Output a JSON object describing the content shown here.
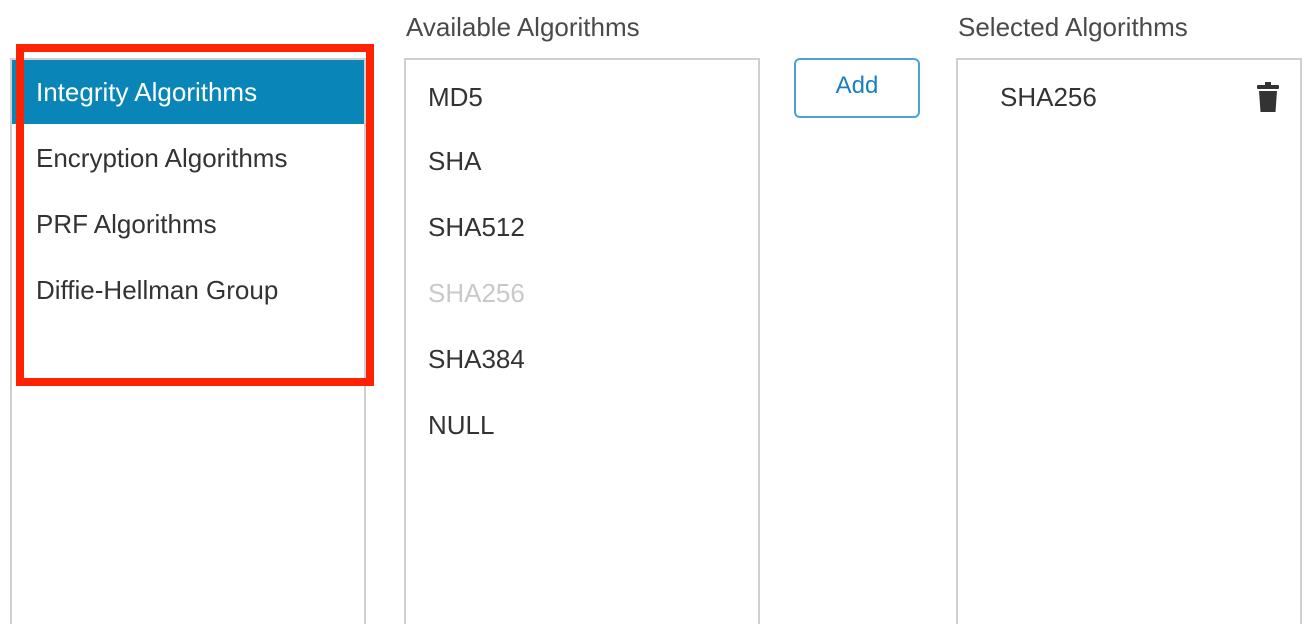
{
  "columns": {
    "available_label": "Available Algorithms",
    "selected_label": "Selected Algorithms"
  },
  "categories": [
    {
      "label": "Integrity Algorithms",
      "active": true
    },
    {
      "label": "Encryption Algorithms",
      "active": false
    },
    {
      "label": "PRF Algorithms",
      "active": false
    },
    {
      "label": "Diffie-Hellman Group",
      "active": false
    }
  ],
  "available": [
    {
      "label": "MD5",
      "disabled": false
    },
    {
      "label": "SHA",
      "disabled": false
    },
    {
      "label": "SHA512",
      "disabled": false
    },
    {
      "label": "SHA256",
      "disabled": true
    },
    {
      "label": "SHA384",
      "disabled": false
    },
    {
      "label": "NULL",
      "disabled": false
    }
  ],
  "add_button_label": "Add",
  "selected": [
    {
      "label": "SHA256",
      "icon": "trash-icon"
    }
  ],
  "colors": {
    "active_bg": "#0a85b8",
    "highlight_border": "#ff2200",
    "button_accent": "#1a7fc0"
  }
}
